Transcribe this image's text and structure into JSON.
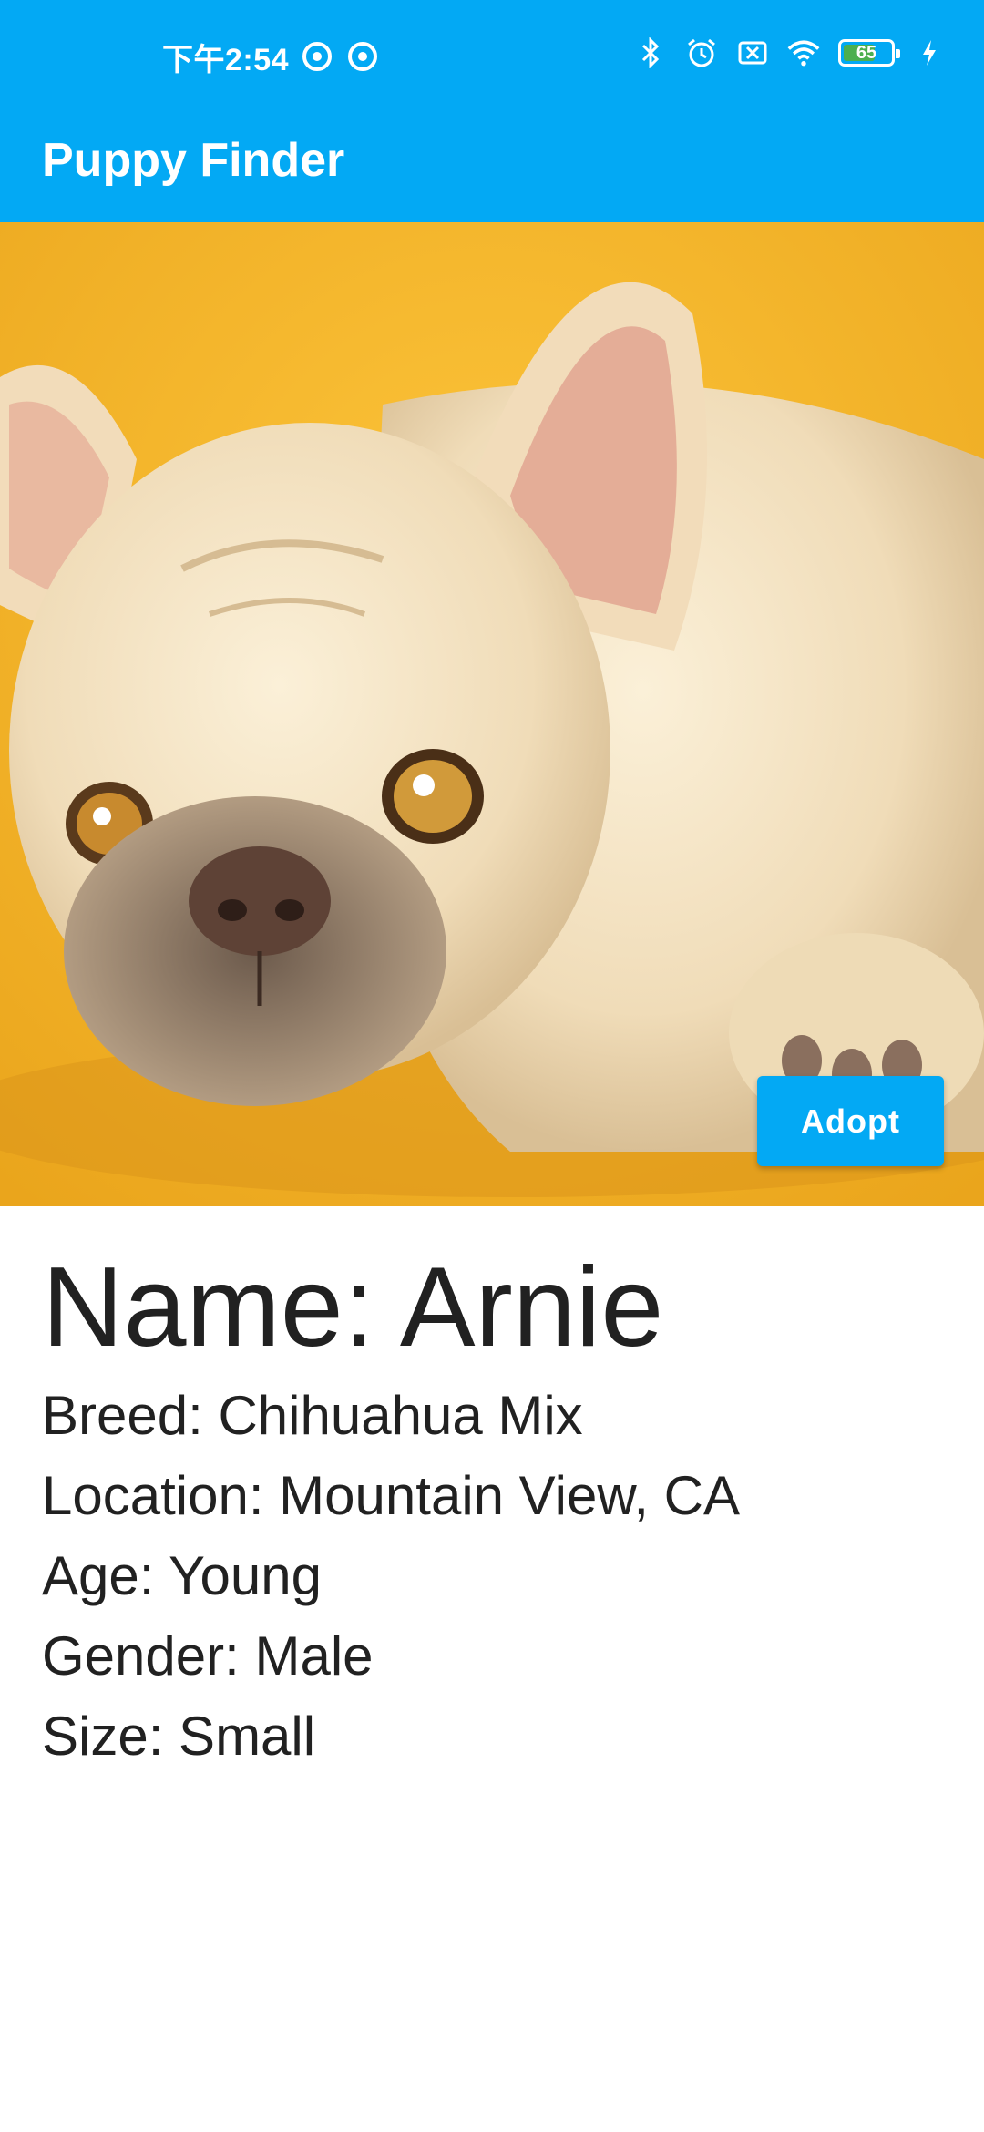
{
  "status_bar": {
    "time": "下午2:54",
    "battery_level": "65",
    "icons": [
      "notification-icon",
      "notification-icon",
      "bluetooth-icon",
      "alarm-icon",
      "sim-off-icon",
      "wifi-icon",
      "battery-icon",
      "charging-icon"
    ]
  },
  "app_bar": {
    "title": "Puppy Finder"
  },
  "puppy": {
    "name": "Name: Arnie",
    "breed": "Breed: Chihuahua Mix",
    "location": "Location: Mountain View, CA",
    "age": "Age: Young",
    "gender": "Gender: Male",
    "size": "Size: Small"
  },
  "actions": {
    "adopt_label": "Adopt"
  },
  "colors": {
    "primary": "#03a9f4",
    "photo_background": "#f6b62a",
    "text": "#212121"
  }
}
